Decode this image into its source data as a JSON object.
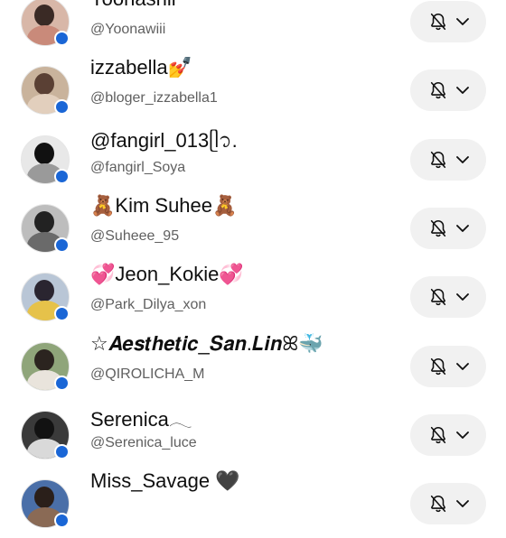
{
  "subscriptions": [
    {
      "name": "Yoonashii",
      "handle": "@Yoonawiii",
      "avatar_colors": {
        "bg": "#d8b7a8",
        "head": "#3a2a25",
        "body": "#c98a7a"
      }
    },
    {
      "name": "izzabella💅",
      "handle": "@bloger_izzabella1",
      "avatar_colors": {
        "bg": "#c9b39c",
        "head": "#5a4034",
        "body": "#e2cfbd"
      }
    },
    {
      "name": "@fangirl_013ᥫ᭡.",
      "handle": "@fangirl_Soya",
      "avatar_colors": {
        "bg": "#e8e8e8",
        "head": "#111111",
        "body": "#9a9a9a"
      }
    },
    {
      "name": "🧸Kim Suhee🧸",
      "handle": "@Suheee_95",
      "avatar_colors": {
        "bg": "#bdbdbd",
        "head": "#222222",
        "body": "#6a6a6a"
      }
    },
    {
      "name": "💞Jeon_Kokie💞",
      "handle": "@Park_Dilya_xon",
      "avatar_colors": {
        "bg": "#b9c6d6",
        "head": "#2a2530",
        "body": "#e6c24a"
      }
    },
    {
      "name": "☆𝑨𝒆𝒔𝒕𝒉𝒆𝒕𝒊𝒄_𝑺𝒂𝒏.𝑳𝒊𝒏ꕤ🐳",
      "handle": "@QIROLICHA_M",
      "avatar_colors": {
        "bg": "#8fa57a",
        "head": "#2b241f",
        "body": "#e9e4dc"
      }
    },
    {
      "name": "Serenica𓂃",
      "handle": "@Serenica_luce",
      "avatar_colors": {
        "bg": "#3a3a3a",
        "head": "#121212",
        "body": "#d9d9d9"
      }
    },
    {
      "name": "Miss_Savage 🖤",
      "handle": "",
      "avatar_colors": {
        "bg": "#4a6fa8",
        "head": "#2a1f1a",
        "body": "#8a6a55"
      }
    }
  ],
  "accent_colors": {
    "online_dot": "#1a66d6",
    "button_bg": "#f1f1f1"
  },
  "button_icons": {
    "bell": "bell-off-icon",
    "chevron": "chevron-down-icon"
  }
}
